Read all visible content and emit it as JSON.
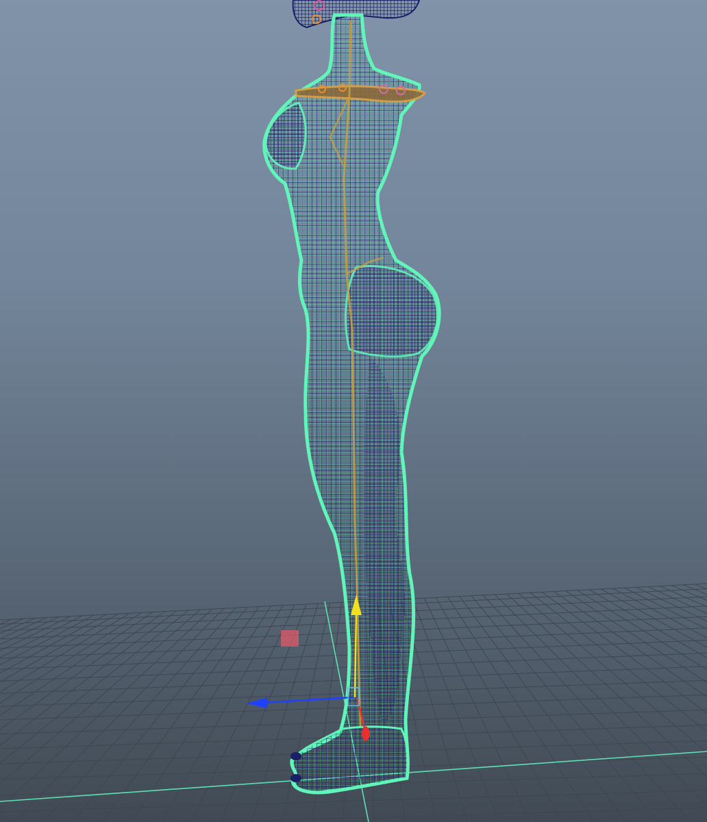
{
  "viewport": {
    "name": "perspective-viewport",
    "display_mode": "wireframe",
    "selected_object": "character-mesh",
    "active_tool": "move-manipulator"
  },
  "colors": {
    "background_top": "#8093a9",
    "background_bottom": "#414a54",
    "grid_line": "#3e4651",
    "grid_axis": "#5fe0b4",
    "wireframe_selected": "#62f5b9",
    "wireframe_unselected": "#1a1f66",
    "manipulator_x": "#e83030",
    "manipulator_y": "#f0e020",
    "manipulator_z": "#2040ff",
    "center_handle": "#e05a6a"
  },
  "icons": {
    "move_manipulator": "move-tool-icon",
    "joint": "joint-icon"
  }
}
